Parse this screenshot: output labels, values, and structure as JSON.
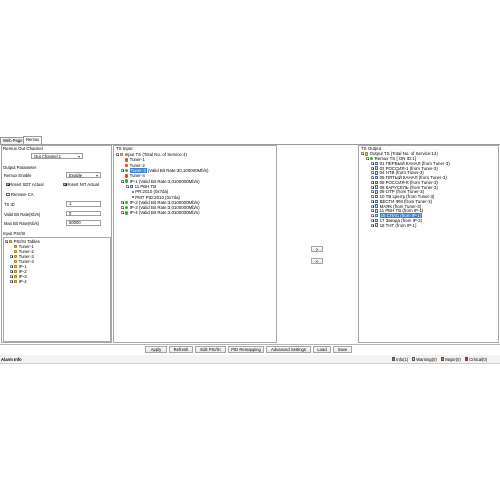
{
  "tabs": [
    "Web Page",
    "Remux"
  ],
  "left": {
    "out_channel_label": "Remux Out Channel",
    "out_channel_value": "Out Channel 1",
    "output_param_label": "Output Parameter",
    "remux_enable_label": "Remux Enable",
    "remux_enable_value": "Enable",
    "insert_sdt_label": "Insert SDT Actual",
    "insert_sdt_checked": true,
    "insert_nit_label": "Insert NIT Actual",
    "insert_nit_checked": true,
    "remove_ca_label": "Remove CA",
    "remove_ca_checked": false,
    "ts_id_label": "TS ID",
    "ts_id_value": "1",
    "valid_bitrate_label": "Valid Bit Rate(Kb/s)",
    "valid_bitrate_value": "0",
    "max_bitrate_label": "Max Bit Rate(Kb/s)",
    "max_bitrate_value": "50000",
    "input_psisi_label": "Input PSI/SI",
    "psisi_tree": [
      {
        "label": "PSI/SI Tables"
      },
      {
        "label": "Tuner-1"
      },
      {
        "label": "Tuner-2"
      },
      {
        "label": "Tuner-3"
      },
      {
        "label": "Tuner-4"
      },
      {
        "label": "IP-1"
      },
      {
        "label": "IP-2"
      },
      {
        "label": "IP-3"
      },
      {
        "label": "IP-4"
      }
    ]
  },
  "ts_input": {
    "title": "TS Input",
    "tree": [
      {
        "label": "Input TS (Total No. of Service:4)"
      },
      {
        "label": "Tuner-1"
      },
      {
        "label": "Tuner-2"
      },
      {
        "label": "Tuner-3",
        "extra": "(Valid Bit Rate:30,100000Mb/s)"
      },
      {
        "label": "Tuner-4"
      },
      {
        "label": "IP-1 (Valid Bit Rate:3,0100000Mb/s)"
      },
      {
        "label": "11 РБН ТВ"
      },
      {
        "label": "PR:2010 (0x7da)"
      },
      {
        "label": "PMT PID:2010 (0x7da)"
      },
      {
        "label": "IP-2 (Valid Bit Rate:3,0100000Mb/s)"
      },
      {
        "label": "IP-3 (Valid Bit Rate:3,0100000Mb/s)"
      },
      {
        "label": "IP-4 (Valid Bit Rate:3,0100000Mb/s)"
      }
    ]
  },
  "transfer": {
    "add_label": ">",
    "remove_label": "<"
  },
  "ts_output": {
    "title": "TS Output",
    "tree": [
      {
        "label": "Output TS (Total No. of Service:14)"
      },
      {
        "label": "Remux TS [ ON ID:1]"
      },
      {
        "label": "01 ПЕРВЫЙ КАНАЛ (from Tuner-3)"
      },
      {
        "label": "02 РОССИЯ-1 (from Tuner-3)"
      },
      {
        "label": "04 НТВ (from Tuner-3)"
      },
      {
        "label": "05 ПЯТЫЙ КАНАЛ (from Tuner-3)"
      },
      {
        "label": "06 РОССИЯ-К (from Tuner-3)"
      },
      {
        "label": "08 КАРУСЕЛЬ (from Tuner-3)"
      },
      {
        "label": "09 ОТР (from Tuner-3)"
      },
      {
        "label": "10 ТВ Центр (from Tuner-3)"
      },
      {
        "label": "ВЕСТИ-ФМ (from Tuner-3)"
      },
      {
        "label": "МАЯК (from Tuner-3)"
      },
      {
        "label": "11 РБН ТВ (from IP-1)"
      },
      {
        "label": "15 СПАС (from IP-1)"
      },
      {
        "label": "17 Звезда (from IP-3)"
      },
      {
        "label": "18 ТНТ (from IP-1)"
      }
    ]
  },
  "buttons": {
    "apply": "Apply",
    "refresh": "Refresh",
    "edit_psisi": "Edit PSI/SI",
    "pid_remapping": "PID Remapping",
    "advanced_settings": "Advanced Settings",
    "load": "Load",
    "save": "Save"
  },
  "alarm": {
    "title": "Alarm Info",
    "info": "Info(1)",
    "warning": "Warning(0)",
    "major": "Major(0)",
    "critical": "Critical(0)"
  },
  "colors": {
    "selection": "#3a7fd7",
    "info": "#3aa63a",
    "warning": "#e8d23a",
    "major": "#e07a2a",
    "critical": "#d22a2a"
  }
}
